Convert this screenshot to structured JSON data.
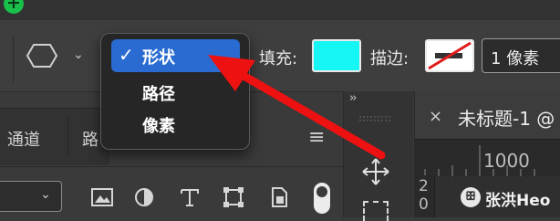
{
  "toolbar": {
    "fill_label": "填充:",
    "stroke_label": "描边:",
    "stroke_width_value": "1 像素",
    "fill_color": "#16f7f5"
  },
  "mode_menu": {
    "items": [
      "形状",
      "路径",
      "像素"
    ],
    "selected_index": 0,
    "check_mark": "✓",
    "highlight_color": "#2a6bd1"
  },
  "panel": {
    "tabs": [
      "通道",
      "路"
    ],
    "menu_icon": "≡"
  },
  "tool_column": {
    "collapse_icon": "››"
  },
  "document": {
    "close_icon": "×",
    "title": "未标题-1 @"
  },
  "ruler": {
    "horizontal_label": "1000",
    "vertical_digits": [
      "2",
      "0"
    ]
  },
  "watermark": {
    "logo": "ꕥ",
    "text": "张洪Heo"
  },
  "annotation": {
    "arrow_color": "#ee1111"
  }
}
